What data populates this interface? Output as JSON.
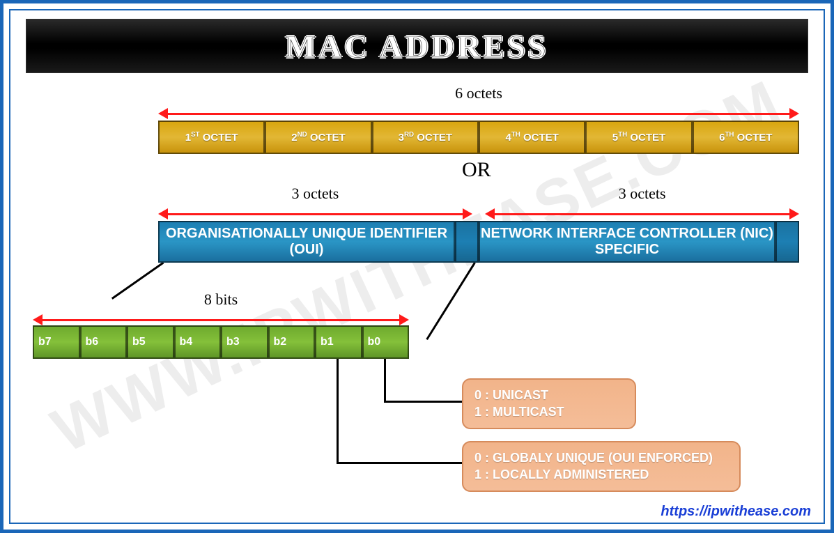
{
  "title": "MAC ADDRESS",
  "watermark": "WWW.IPWITHEASE.COM",
  "footer_url": "https://ipwithease.com",
  "spans": {
    "full": "6 octets",
    "left_half": "3 octets",
    "right_half": "3 octets",
    "bits": "8 bits"
  },
  "or_text": "OR",
  "octets_row": {
    "cells": [
      {
        "num": "1",
        "suf": "ST",
        "word": "OCTET"
      },
      {
        "num": "2",
        "suf": "ND",
        "word": "OCTET"
      },
      {
        "num": "3",
        "suf": "RD",
        "word": "OCTET"
      },
      {
        "num": "4",
        "suf": "TH",
        "word": "OCTET"
      },
      {
        "num": "5",
        "suf": "TH",
        "word": "OCTET"
      },
      {
        "num": "6",
        "suf": "TH",
        "word": "OCTET"
      }
    ]
  },
  "oui_nic_row": {
    "left": "ORGANISATIONALLY UNIQUE IDENTIFIER (OUI)",
    "right": "NETWORK INTERFACE CONTROLLER (NIC) SPECIFIC"
  },
  "bits_row": {
    "cells": [
      "b7",
      "b6",
      "b5",
      "b4",
      "b3",
      "b2",
      "b1",
      "b0"
    ]
  },
  "callouts": {
    "b0": {
      "line0": "0 : UNICAST",
      "line1": "1 : MULTICAST"
    },
    "b1": {
      "line0": "0 : GLOBALY UNIQUE (OUI ENFORCED)",
      "line1": "1 : LOCALLY ADMINISTERED"
    }
  }
}
